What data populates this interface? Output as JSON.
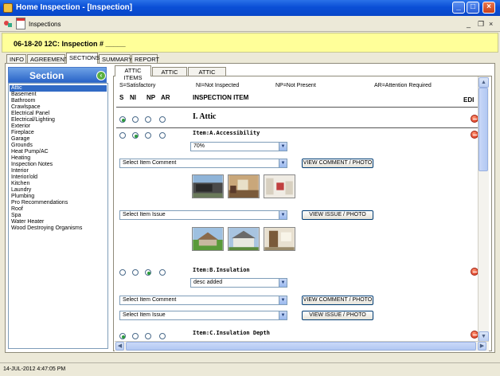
{
  "window": {
    "title": "Home Inspection - [Inspection]",
    "minimize": "_",
    "maximize": "□",
    "close": "×"
  },
  "mdi": {
    "title": "Inspections",
    "minimize": "_",
    "restore": "❐",
    "close": "×"
  },
  "header": {
    "text": "06-18-20 12C: Inspection # _____"
  },
  "main_tabs": [
    {
      "label": "INFO"
    },
    {
      "label": "AGREEMENT"
    },
    {
      "label": "SECTIONS"
    },
    {
      "label": "SUMMARY"
    },
    {
      "label": "REPORT"
    }
  ],
  "section_panel": {
    "title": "Section",
    "items": [
      "Attic",
      "Basement",
      "Bathroom",
      "Crawlspace",
      "Electrical Panel",
      "Electrical/Lighting",
      "Exterior",
      "Fireplace",
      "Garage",
      "Grounds",
      "Heat Pump/AC",
      "Heating",
      "Inspection Notes",
      "Interior",
      "Interior/old",
      "Kitchen",
      "Laundry",
      "Plumbing",
      "Pro Recommendations",
      "Roof",
      "Spa",
      "Water Heater",
      "Wood Destroying Organisms"
    ],
    "selected": "Attic"
  },
  "sub_tabs": [
    {
      "label": "ATTIC ITEMS"
    },
    {
      "label": "ATTIC INFO"
    },
    {
      "label": "ATTIC NOTES"
    }
  ],
  "legend": {
    "s": "S=Satisfactory",
    "ni": "NI=Not Inspected",
    "np": "NP=Not Present",
    "ar": "AR=Attention Required"
  },
  "columns": {
    "s": "S",
    "ni": "NI",
    "np": "NP",
    "ar": "AR",
    "item": "INSPECTION ITEM",
    "edit": "EDI"
  },
  "section_title": "I. Attic",
  "items": [
    {
      "title": "Item:A.Accessibility",
      "value": "70%",
      "comment_placeholder": "Select Item Comment",
      "comment_button": "VIEW COMMENT / PHOTO",
      "issue_placeholder": "Select Item Issue",
      "issue_button": "VIEW ISSUE / PHOTO"
    },
    {
      "title": "Item:B.Insulation",
      "value": "desc added",
      "comment_placeholder": "Select Item Comment",
      "comment_button": "VIEW COMMENT / PHOTO",
      "issue_placeholder": "Select Item Issue",
      "issue_button": "VIEW ISSUE / PHOTO"
    },
    {
      "title": "Item:C.Insulation Depth"
    }
  ],
  "status_bar": {
    "text": "14-JUL-2012   4:47:05 PM"
  },
  "colors": {
    "selected": "#316ac5",
    "header_bg": "#ffff99",
    "radio_check": "#2c9b3c",
    "delete": "#d8321a"
  }
}
